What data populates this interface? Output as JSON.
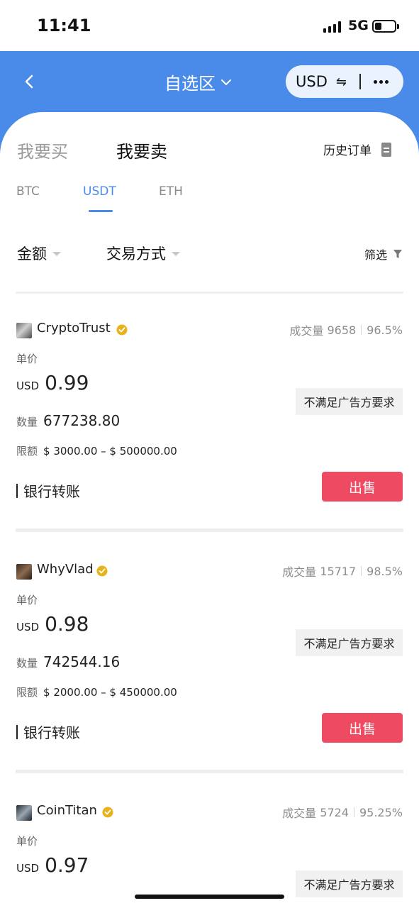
{
  "status_bar": {
    "time": "11:41",
    "network": "5G",
    "battery_level": 0.35
  },
  "nav": {
    "title": "自选区",
    "currency": "USD",
    "swap_symbol": "⇋"
  },
  "trade_tabs": {
    "buy": "我要买",
    "sell": "我要卖",
    "history": "历史订单"
  },
  "coin_tabs": [
    "BTC",
    "USDT",
    "ETH"
  ],
  "active_coin": "USDT",
  "filters": {
    "amount": "金额",
    "method": "交易方式",
    "screen": "筛选"
  },
  "listings": [
    {
      "merchant": "CryptoTrust",
      "volume_label": "成交量",
      "volume": "9658",
      "completion_rate": "96.5%",
      "price_label": "单价",
      "currency": "USD",
      "price": "0.99",
      "qty_label": "数量",
      "quantity": "677238.80",
      "limit_label": "限额",
      "limit": "$ 3000.00 – $ 500000.00",
      "requirement": "不满足广告方要求",
      "payment": "银行转账",
      "action": "出售"
    },
    {
      "merchant": "WhyVlad",
      "volume_label": "成交量",
      "volume": "15717",
      "completion_rate": "98.5%",
      "price_label": "单价",
      "currency": "USD",
      "price": "0.98",
      "qty_label": "数量",
      "quantity": "742544.16",
      "limit_label": "限额",
      "limit": "$ 2000.00 – $ 450000.00",
      "requirement": "不满足广告方要求",
      "payment": "银行转账",
      "action": "出售"
    },
    {
      "merchant": "CoinTitan",
      "volume_label": "成交量",
      "volume": "5724",
      "completion_rate": "95.25%",
      "price_label": "单价",
      "currency": "USD",
      "price": "0.97",
      "requirement": "不满足广告方要求"
    }
  ],
  "colors": {
    "nav_blue": "#4a8ae8",
    "sell_red": "#ee4b62",
    "verified_gold": "#e8b21c"
  }
}
